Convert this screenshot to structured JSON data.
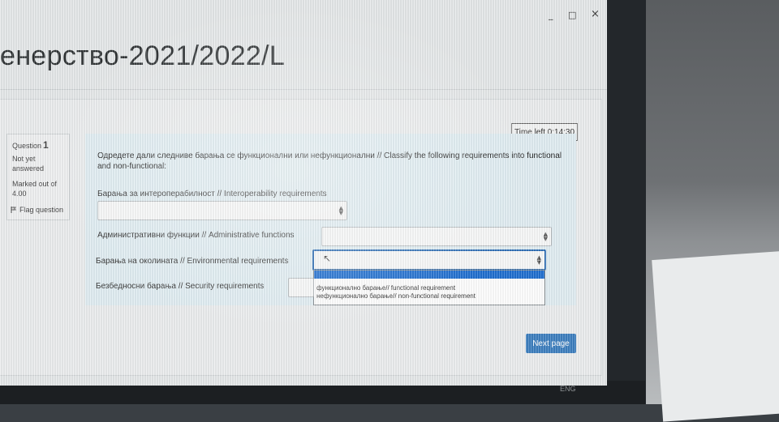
{
  "window": {
    "minimize": "_",
    "maximize": "□",
    "close": "×"
  },
  "course": {
    "title": "енерство-2021/2022/L"
  },
  "question_info": {
    "label": "Question",
    "number": "1",
    "status": "Not yet answered",
    "marks": "Marked out of 4.00",
    "flag_label": "Flag question"
  },
  "timer": {
    "text": "Time left 0:14:30"
  },
  "question": {
    "text_line1": "Одредете дали следниве барања се функционални или нефункционални // Classify the following requirements into functional",
    "text_line2": "and non-functional:",
    "items": [
      {
        "label": "Барања за интероперабилност // Interoperability requirements",
        "value": ""
      },
      {
        "label": "Административни функции // Administrative functions",
        "value": ""
      },
      {
        "label": "Барања на околината // Environmental requirements",
        "value": ""
      },
      {
        "label": "Безбедносни барања // Security requirements",
        "value": ""
      }
    ],
    "dropdown_options": [
      "",
      "функционално барање// functional requirement",
      "нефункционално барање// non-functional requirement"
    ]
  },
  "navigation": {
    "next_label": "Next page"
  },
  "taskbar": {
    "lang": "ENG"
  }
}
